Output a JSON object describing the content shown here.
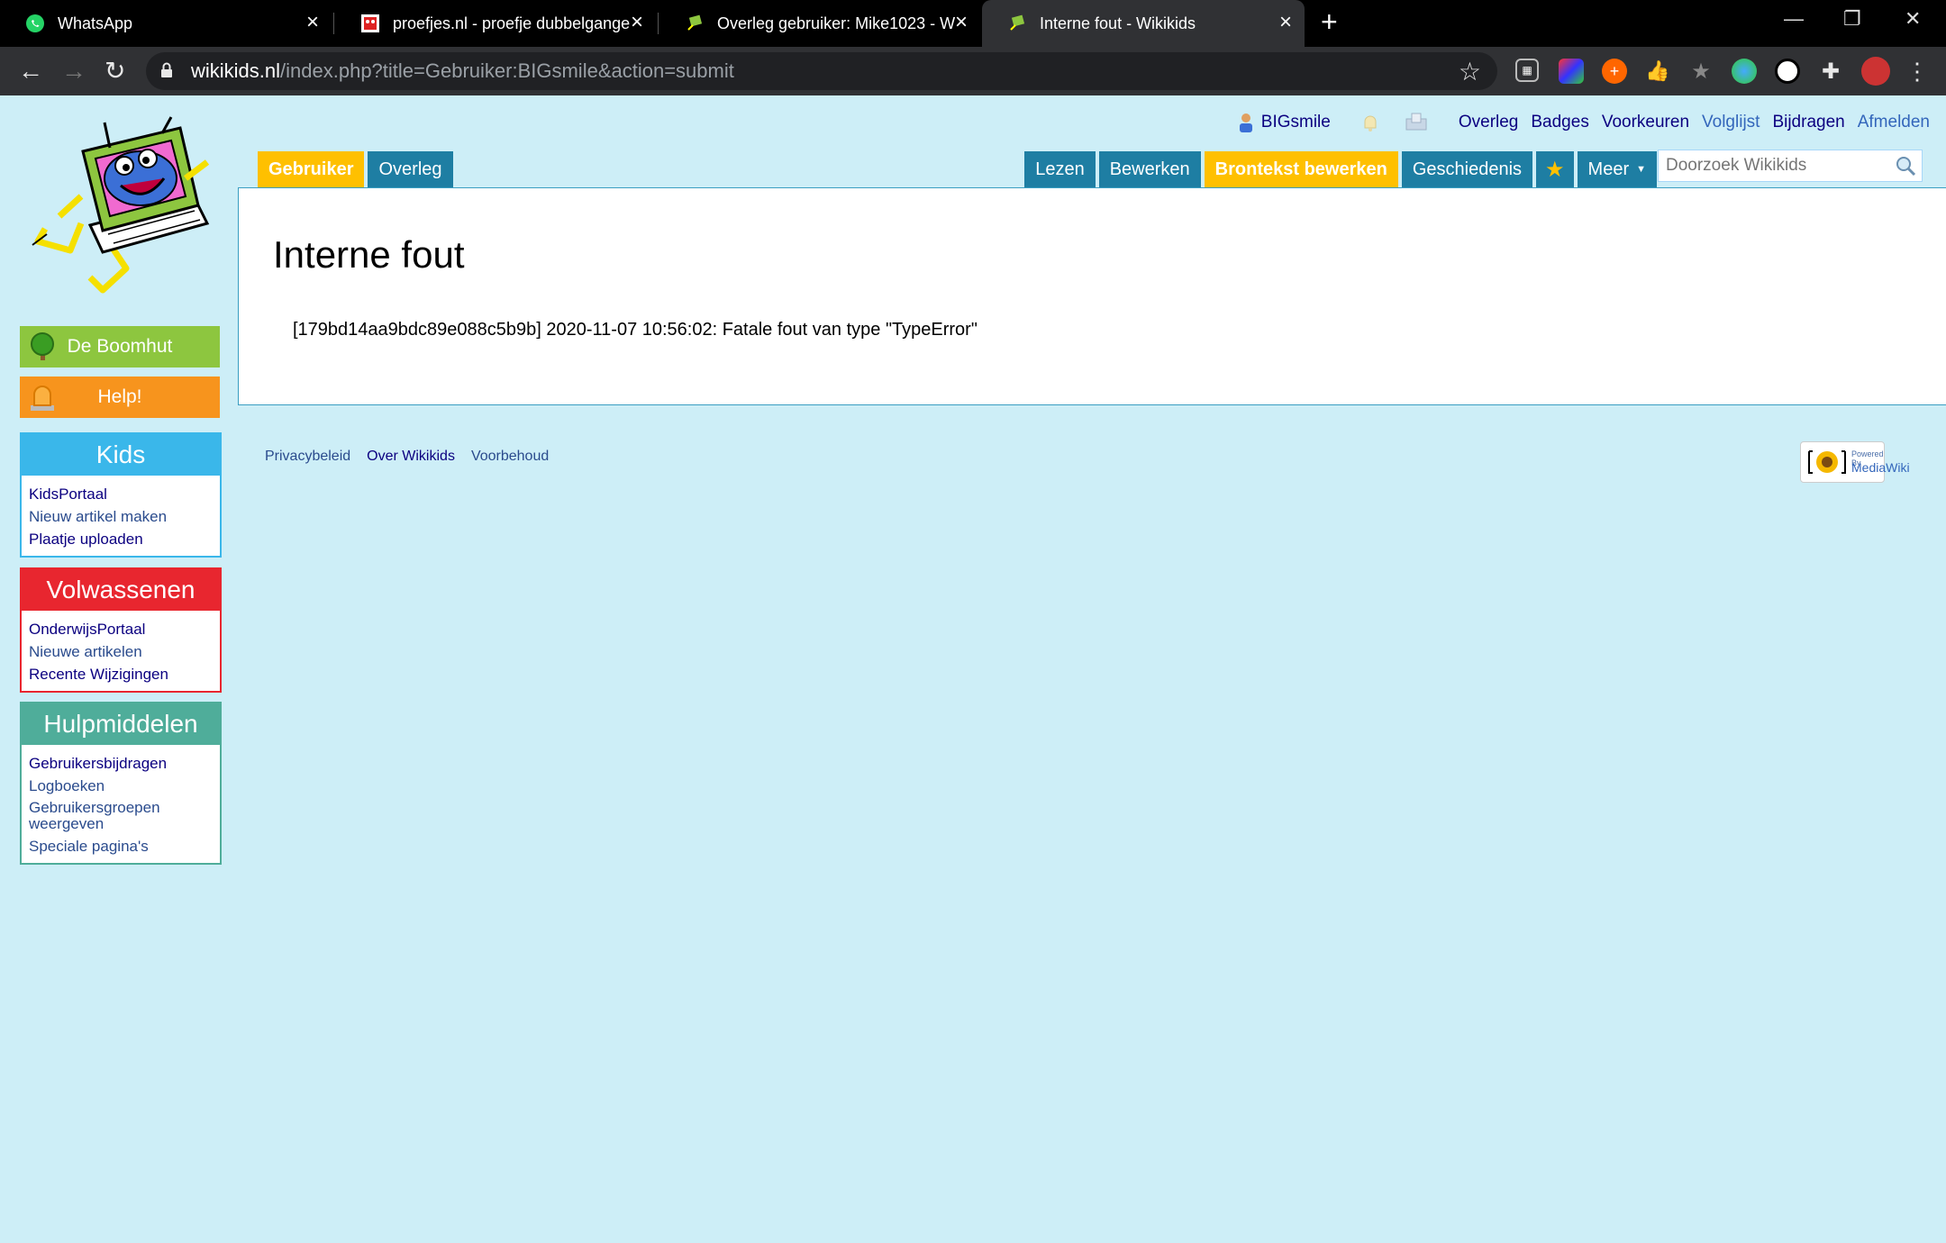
{
  "browser": {
    "tabs": [
      {
        "title": "WhatsApp",
        "icon": "whatsapp-icon"
      },
      {
        "title": "proefjes.nl - proefje dubbelgange",
        "icon": "proefjes-icon"
      },
      {
        "title": "Overleg gebruiker: Mike1023 - W",
        "icon": "wikikids-icon"
      },
      {
        "title": "Interne fout - Wikikids",
        "icon": "wikikids-icon"
      }
    ],
    "url_domain": "wikikids.nl",
    "url_path": "/index.php?title=Gebruiker:BIGsmile&action=submit"
  },
  "personal": {
    "username": "BIGsmile",
    "links": [
      "Overleg",
      "Badges",
      "Voorkeuren",
      "Volglijst",
      "Bijdragen",
      "Afmelden"
    ]
  },
  "nav": {
    "left_tabs": [
      "Gebruiker",
      "Overleg"
    ],
    "right_tabs": [
      "Lezen",
      "Bewerken",
      "Brontekst bewerken",
      "Geschiedenis"
    ],
    "more_label": "Meer",
    "search_placeholder": "Doorzoek Wikikids"
  },
  "sidebar": {
    "portal_buttons": [
      "De Boomhut",
      "Help!"
    ],
    "kids": {
      "title": "Kids",
      "items": [
        "KidsPortaal",
        "Nieuw artikel maken",
        "Plaatje uploaden"
      ]
    },
    "adults": {
      "title": "Volwassenen",
      "items": [
        "OnderwijsPortaal",
        "Nieuwe artikelen",
        "Recente Wijzigingen"
      ]
    },
    "tools": {
      "title": "Hulpmiddelen",
      "items": [
        "Gebruikersbijdragen",
        "Logboeken",
        "Gebruikersgroepen weergeven",
        "Speciale pagina's"
      ]
    }
  },
  "content": {
    "title": "Interne fout",
    "error": "[179bd14aa9bdc89e088c5b9b] 2020-11-07 10:56:02: Fatale fout van type \"TypeError\""
  },
  "footer": {
    "links": [
      "Privacybeleid",
      "Over Wikikids",
      "Voorbehoud"
    ],
    "powered_small": "Powered By",
    "powered_big": "MediaWiki"
  },
  "colors": {
    "page_bg": "#cdeef7",
    "tab_blue": "#1e7ea3",
    "tab_selected": "#ffc000",
    "boomhut_green": "#8dc63f",
    "help_orange": "#f7941d",
    "kids_blue": "#3ab7ea",
    "adults_red": "#e8262f",
    "tools_teal": "#4fad9a"
  }
}
